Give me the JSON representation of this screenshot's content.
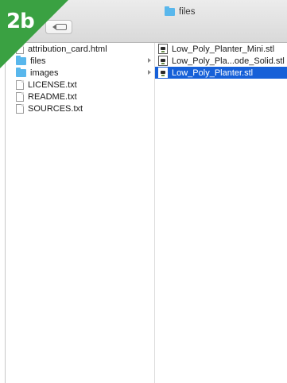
{
  "badge": {
    "label": "2b"
  },
  "window": {
    "title": "files"
  },
  "column1": {
    "items": [
      {
        "name": "attribution_card.html",
        "type": "file"
      },
      {
        "name": "files",
        "type": "folder"
      },
      {
        "name": "images",
        "type": "folder"
      },
      {
        "name": "LICENSE.txt",
        "type": "file"
      },
      {
        "name": "README.txt",
        "type": "file"
      },
      {
        "name": "SOURCES.txt",
        "type": "file"
      }
    ]
  },
  "column2": {
    "items": [
      {
        "name": "Low_Poly_Planter_Mini.stl",
        "type": "stl"
      },
      {
        "name": "Low_Poly_Pla...ode_Solid.stl",
        "type": "stl"
      },
      {
        "name": "Low_Poly_Planter.stl",
        "type": "stl",
        "selected": true
      }
    ]
  },
  "colors": {
    "badge": "#3aa142",
    "selection": "#1660d8",
    "folder": "#59b7ec"
  },
  "icons": {
    "title_folder": "folder-icon",
    "tag_button": "tag-icon",
    "file": "document-icon",
    "stl": "stl-file-icon",
    "folder": "folder-icon"
  }
}
